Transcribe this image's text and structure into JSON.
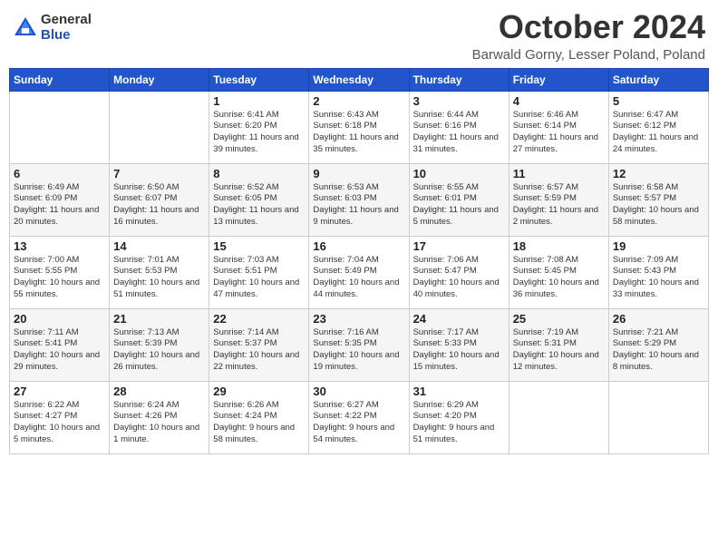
{
  "header": {
    "logo_general": "General",
    "logo_blue": "Blue",
    "month_title": "October 2024",
    "location": "Barwald Gorny, Lesser Poland, Poland"
  },
  "days_of_week": [
    "Sunday",
    "Monday",
    "Tuesday",
    "Wednesday",
    "Thursday",
    "Friday",
    "Saturday"
  ],
  "weeks": [
    [
      {
        "day": "",
        "content": ""
      },
      {
        "day": "",
        "content": ""
      },
      {
        "day": "1",
        "content": "Sunrise: 6:41 AM\nSunset: 6:20 PM\nDaylight: 11 hours and 39 minutes."
      },
      {
        "day": "2",
        "content": "Sunrise: 6:43 AM\nSunset: 6:18 PM\nDaylight: 11 hours and 35 minutes."
      },
      {
        "day": "3",
        "content": "Sunrise: 6:44 AM\nSunset: 6:16 PM\nDaylight: 11 hours and 31 minutes."
      },
      {
        "day": "4",
        "content": "Sunrise: 6:46 AM\nSunset: 6:14 PM\nDaylight: 11 hours and 27 minutes."
      },
      {
        "day": "5",
        "content": "Sunrise: 6:47 AM\nSunset: 6:12 PM\nDaylight: 11 hours and 24 minutes."
      }
    ],
    [
      {
        "day": "6",
        "content": "Sunrise: 6:49 AM\nSunset: 6:09 PM\nDaylight: 11 hours and 20 minutes."
      },
      {
        "day": "7",
        "content": "Sunrise: 6:50 AM\nSunset: 6:07 PM\nDaylight: 11 hours and 16 minutes."
      },
      {
        "day": "8",
        "content": "Sunrise: 6:52 AM\nSunset: 6:05 PM\nDaylight: 11 hours and 13 minutes."
      },
      {
        "day": "9",
        "content": "Sunrise: 6:53 AM\nSunset: 6:03 PM\nDaylight: 11 hours and 9 minutes."
      },
      {
        "day": "10",
        "content": "Sunrise: 6:55 AM\nSunset: 6:01 PM\nDaylight: 11 hours and 5 minutes."
      },
      {
        "day": "11",
        "content": "Sunrise: 6:57 AM\nSunset: 5:59 PM\nDaylight: 11 hours and 2 minutes."
      },
      {
        "day": "12",
        "content": "Sunrise: 6:58 AM\nSunset: 5:57 PM\nDaylight: 10 hours and 58 minutes."
      }
    ],
    [
      {
        "day": "13",
        "content": "Sunrise: 7:00 AM\nSunset: 5:55 PM\nDaylight: 10 hours and 55 minutes."
      },
      {
        "day": "14",
        "content": "Sunrise: 7:01 AM\nSunset: 5:53 PM\nDaylight: 10 hours and 51 minutes."
      },
      {
        "day": "15",
        "content": "Sunrise: 7:03 AM\nSunset: 5:51 PM\nDaylight: 10 hours and 47 minutes."
      },
      {
        "day": "16",
        "content": "Sunrise: 7:04 AM\nSunset: 5:49 PM\nDaylight: 10 hours and 44 minutes."
      },
      {
        "day": "17",
        "content": "Sunrise: 7:06 AM\nSunset: 5:47 PM\nDaylight: 10 hours and 40 minutes."
      },
      {
        "day": "18",
        "content": "Sunrise: 7:08 AM\nSunset: 5:45 PM\nDaylight: 10 hours and 36 minutes."
      },
      {
        "day": "19",
        "content": "Sunrise: 7:09 AM\nSunset: 5:43 PM\nDaylight: 10 hours and 33 minutes."
      }
    ],
    [
      {
        "day": "20",
        "content": "Sunrise: 7:11 AM\nSunset: 5:41 PM\nDaylight: 10 hours and 29 minutes."
      },
      {
        "day": "21",
        "content": "Sunrise: 7:13 AM\nSunset: 5:39 PM\nDaylight: 10 hours and 26 minutes."
      },
      {
        "day": "22",
        "content": "Sunrise: 7:14 AM\nSunset: 5:37 PM\nDaylight: 10 hours and 22 minutes."
      },
      {
        "day": "23",
        "content": "Sunrise: 7:16 AM\nSunset: 5:35 PM\nDaylight: 10 hours and 19 minutes."
      },
      {
        "day": "24",
        "content": "Sunrise: 7:17 AM\nSunset: 5:33 PM\nDaylight: 10 hours and 15 minutes."
      },
      {
        "day": "25",
        "content": "Sunrise: 7:19 AM\nSunset: 5:31 PM\nDaylight: 10 hours and 12 minutes."
      },
      {
        "day": "26",
        "content": "Sunrise: 7:21 AM\nSunset: 5:29 PM\nDaylight: 10 hours and 8 minutes."
      }
    ],
    [
      {
        "day": "27",
        "content": "Sunrise: 6:22 AM\nSunset: 4:27 PM\nDaylight: 10 hours and 5 minutes."
      },
      {
        "day": "28",
        "content": "Sunrise: 6:24 AM\nSunset: 4:26 PM\nDaylight: 10 hours and 1 minute."
      },
      {
        "day": "29",
        "content": "Sunrise: 6:26 AM\nSunset: 4:24 PM\nDaylight: 9 hours and 58 minutes."
      },
      {
        "day": "30",
        "content": "Sunrise: 6:27 AM\nSunset: 4:22 PM\nDaylight: 9 hours and 54 minutes."
      },
      {
        "day": "31",
        "content": "Sunrise: 6:29 AM\nSunset: 4:20 PM\nDaylight: 9 hours and 51 minutes."
      },
      {
        "day": "",
        "content": ""
      },
      {
        "day": "",
        "content": ""
      }
    ]
  ]
}
